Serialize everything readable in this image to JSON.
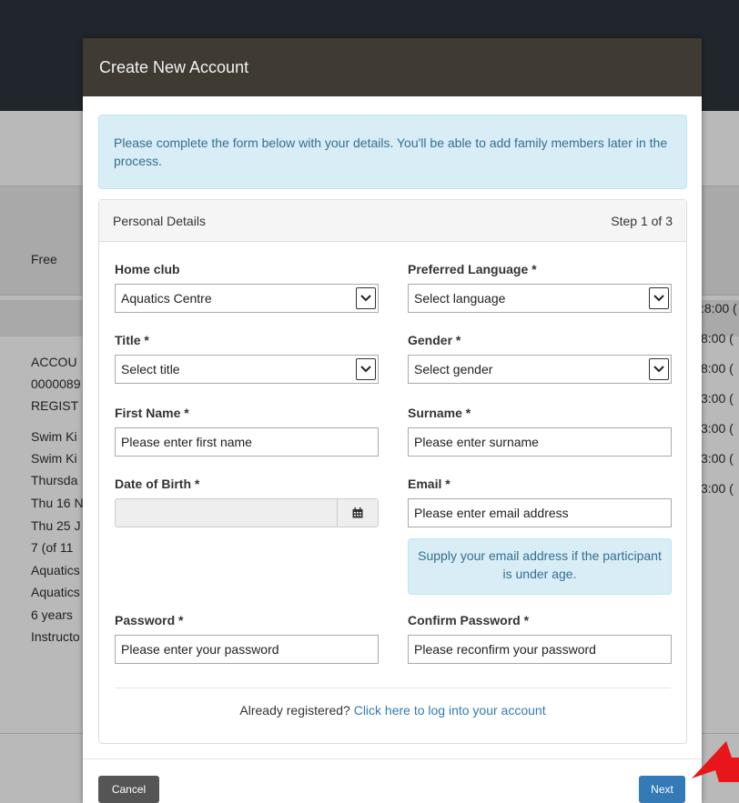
{
  "background": {
    "col_free": "Free",
    "left_lines": [
      "ACCOU",
      "0000089",
      "REGIST",
      "Swim Ki",
      "Swim Ki",
      "Thursda",
      "Thu 16 N",
      "Thu 25 J",
      "7 (of 11",
      "Aquatics",
      "Aquatics",
      "6 years",
      "Instructo"
    ],
    "right_times": [
      ":8:00 (",
      "8:00 (",
      "8:00 (",
      "3:00 (",
      "3:00 (",
      "3:00 (",
      "3:00 ("
    ]
  },
  "modal": {
    "title": "Create New Account",
    "info": "Please complete the form below with your details. You'll be able to add family members later in the process.",
    "panel_title": "Personal Details",
    "step": "Step 1 of 3",
    "fields": {
      "home_club": {
        "label": "Home club",
        "value": "Aquatics Centre"
      },
      "language": {
        "label": "Preferred Language *",
        "value": "Select language"
      },
      "title": {
        "label": "Title *",
        "value": "Select title"
      },
      "gender": {
        "label": "Gender *",
        "value": "Select gender"
      },
      "first_name": {
        "label": "First Name *",
        "placeholder": "Please enter first name"
      },
      "surname": {
        "label": "Surname *",
        "placeholder": "Please enter surname"
      },
      "dob": {
        "label": "Date of Birth *"
      },
      "email": {
        "label": "Email *",
        "placeholder": "Please enter email address",
        "hint": "Supply your email address if the participant is under age."
      },
      "password": {
        "label": "Password *",
        "placeholder": "Please enter your password"
      },
      "confirm": {
        "label": "Confirm Password *",
        "placeholder": "Please reconfirm your password"
      }
    },
    "already_registered": "Already registered?",
    "login_link": "Click here to log into your account",
    "cancel": "Cancel",
    "next": "Next"
  },
  "icons": {
    "calendar": "calendar-icon",
    "select_arrow": "chevron-down-icon",
    "pointer": "red-arrow-icon"
  },
  "colors": {
    "header": "#3f3a32",
    "info_bg": "#d9edf7",
    "info_text": "#31708f",
    "primary": "#337ab7",
    "cancel": "#555555",
    "pointer": "#e8151b"
  }
}
